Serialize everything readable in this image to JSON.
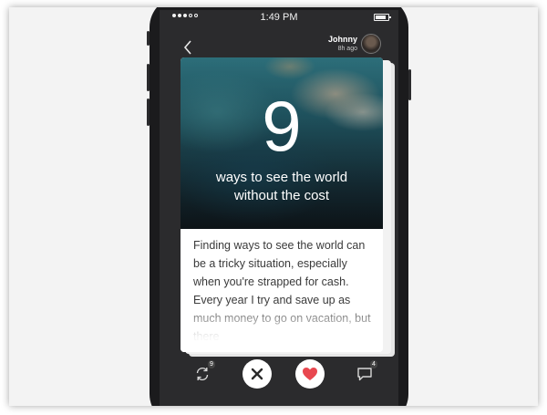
{
  "status_bar": {
    "time": "1:49 PM"
  },
  "header": {
    "author_name": "Johnny",
    "author_time": "8h ago"
  },
  "card": {
    "big_number": "9",
    "headline_line1": "ways to see the world",
    "headline_line2": "without the cost",
    "body": "Finding ways to see the world can be a tricky situation, especially when you're strapped for cash. Every year I try and save up as much money to go on vacation, but there"
  },
  "actions": {
    "reshare_count": "9",
    "comment_count": "4"
  },
  "colors": {
    "like": "#e8474f",
    "dismiss": "#2a2a2a"
  }
}
